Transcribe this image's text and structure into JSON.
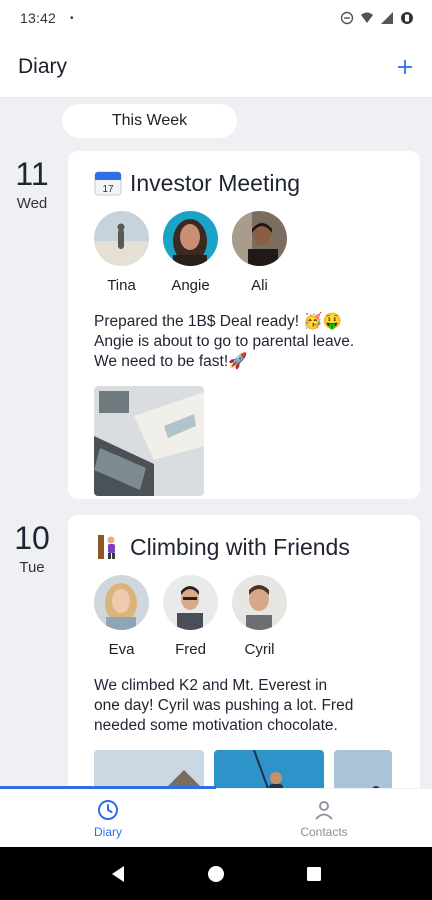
{
  "status_bar": {
    "time": "13:42",
    "dot": "•"
  },
  "app_bar": {
    "title": "Diary",
    "add_icon": "plus-icon"
  },
  "section": {
    "label": "This Week"
  },
  "entries": [
    {
      "day_number": "11",
      "day_name": "Wed",
      "title": "Investor Meeting",
      "title_icon": "calendar-emoji-icon",
      "people": [
        {
          "name": "Tina"
        },
        {
          "name": "Angie"
        },
        {
          "name": "Ali"
        }
      ],
      "note_lines": [
        "Prepared the 1B$ Deal ready! 🥳🤑",
        "Angie is about to go to parental leave.",
        "We need to be fast!🚀"
      ]
    },
    {
      "day_number": "10",
      "day_name": "Tue",
      "title": "Climbing with Friends",
      "title_icon": "climber-emoji-icon",
      "people": [
        {
          "name": "Eva"
        },
        {
          "name": "Fred"
        },
        {
          "name": "Cyril"
        }
      ],
      "note_lines": [
        "We climbed K2 and Mt. Everest in",
        "one day! Cyril was pushing a lot. Fred",
        "needed some motivation chocolate."
      ]
    }
  ],
  "bottom_nav": {
    "items": [
      {
        "label": "Diary",
        "icon": "clock-icon",
        "active": true
      },
      {
        "label": "Contacts",
        "icon": "person-icon",
        "active": false
      }
    ]
  },
  "colors": {
    "accent": "#2f6fe4",
    "background": "#eef0f3"
  }
}
